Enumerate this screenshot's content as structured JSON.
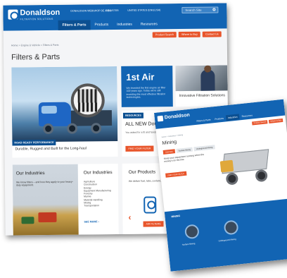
{
  "main": {
    "brand": {
      "name": "Donaldson",
      "tagline": "FILTRATION SOLUTIONS"
    },
    "utility_links": [
      "DONALDSON WEBSHOP DE & BA",
      "REGISTER",
      "UNITED STATES (ENGLISH)"
    ],
    "search_placeholder": "Search Site",
    "nav": [
      "Filters & Parts",
      "Products",
      "Industries",
      "Resources"
    ],
    "actions": [
      "Product Search",
      "Where to Buy",
      "Contact Us"
    ],
    "breadcrumb": "Home  >  Engine & Vehicle  >  Filters & Parts",
    "page_title": "Filters & Parts",
    "hero": {
      "badge": "ROAD READY PERFORMANCE",
      "caption": "Durable, Rugged and Built for the Long-haul"
    },
    "first_air": {
      "title": "1st Air",
      "text": "We invented the first engine air filter 100 years ago. Today we're still inventing the most effective filtration technologies."
    },
    "lab": {
      "caption": "Innovative Filtration Solutions"
    },
    "resources": {
      "badge": "RESOURCES",
      "title": "ALL NEW Donaldson Product",
      "text": "You asked for a fit and functional guide with more intuitive, more complete",
      "button": "FIND YOUR FILTER"
    },
    "industries": {
      "left_title": "Our Industries",
      "left_text": "We know filters – and how they apply to your heavy-duty equipment.",
      "right_title": "Our Industries",
      "list": [
        "Agriculture",
        "Construction",
        "Energy",
        "Equipment Manufacturing",
        "Forestry",
        "Marine",
        "Material Handling",
        "Mining",
        "Transportation"
      ],
      "more": "SEE MORE ›"
    },
    "products": {
      "title": "Our Products",
      "text": "We deliver fuel, lube, coolant, air, hydraulic and bulk tank filtration",
      "chevron": "‹",
      "button": "AIR FILTERS"
    }
  },
  "sub": {
    "brand": "Donaldson",
    "nav": [
      "Filters & Parts",
      "Products",
      "Industries",
      "Resources"
    ],
    "actions": [
      "Product Search",
      "Where to Buy"
    ],
    "breadcrumb": "Home > Industries > Mining",
    "page_title": "Mining",
    "tabs": [
      "Overview",
      "Surface Mining",
      "Underground Mining"
    ],
    "intro": "Keep your equipment running when the money's on the line.",
    "button": "FIND YOUR FILTER",
    "band_label": "MINING",
    "categories": [
      "Surface Mining",
      "Underground Mining"
    ]
  },
  "colors": {
    "brand_blue": "#1264b3",
    "accent_orange": "#e8552b",
    "dark_blue": "#0b4f91"
  }
}
